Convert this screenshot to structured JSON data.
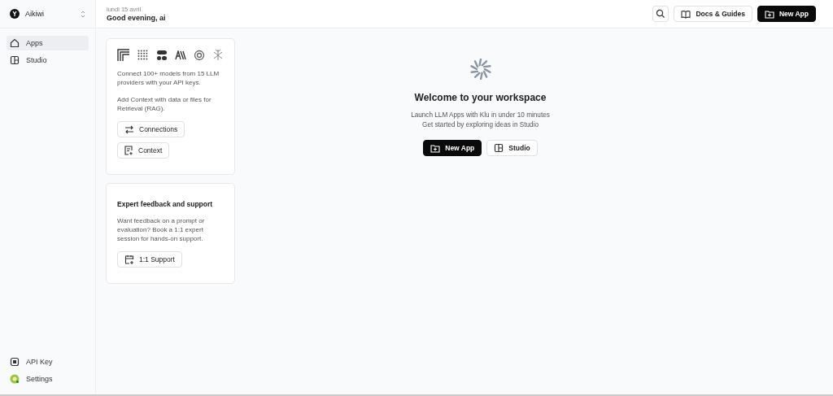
{
  "workspace": {
    "name": "Aikiwi"
  },
  "nav": [
    {
      "label": "Apps",
      "kind": "home",
      "selected": true
    },
    {
      "label": "Studio",
      "kind": "studio",
      "selected": false
    }
  ],
  "bottom_nav": [
    {
      "label": "API Key",
      "kind": "key"
    },
    {
      "label": "Settings",
      "kind": "avatar"
    }
  ],
  "header": {
    "date": "lundi 15 avril",
    "greeting": "Good evening, ai",
    "docs_button": "Docs & Guides",
    "new_button": "New App"
  },
  "cards": [
    {
      "kind": "providers",
      "paragraphs": [
        "Connect 100+ models from 15 LLM providers with your API keys.",
        "Add Context with data or files for Retrieval (RAG)."
      ],
      "buttons": [
        {
          "label": "Connections",
          "kind": "arrows"
        },
        {
          "label": "Context",
          "kind": "doc"
        }
      ]
    },
    {
      "kind": "support",
      "title": "Expert feedback and support",
      "paragraphs": [
        "Want feedback on a prompt or evaluation? Book a 1:1 expert session for hands-on support."
      ],
      "buttons": [
        {
          "label": "1:1 Support",
          "kind": "calendar"
        }
      ]
    }
  ],
  "welcome": {
    "title": "Welcome to your workspace",
    "lines": [
      "Launch LLM Apps with Klu in under 10 minutes",
      "Get started by exploring ideas in Studio"
    ],
    "primary": "New App",
    "secondary": "Studio"
  }
}
